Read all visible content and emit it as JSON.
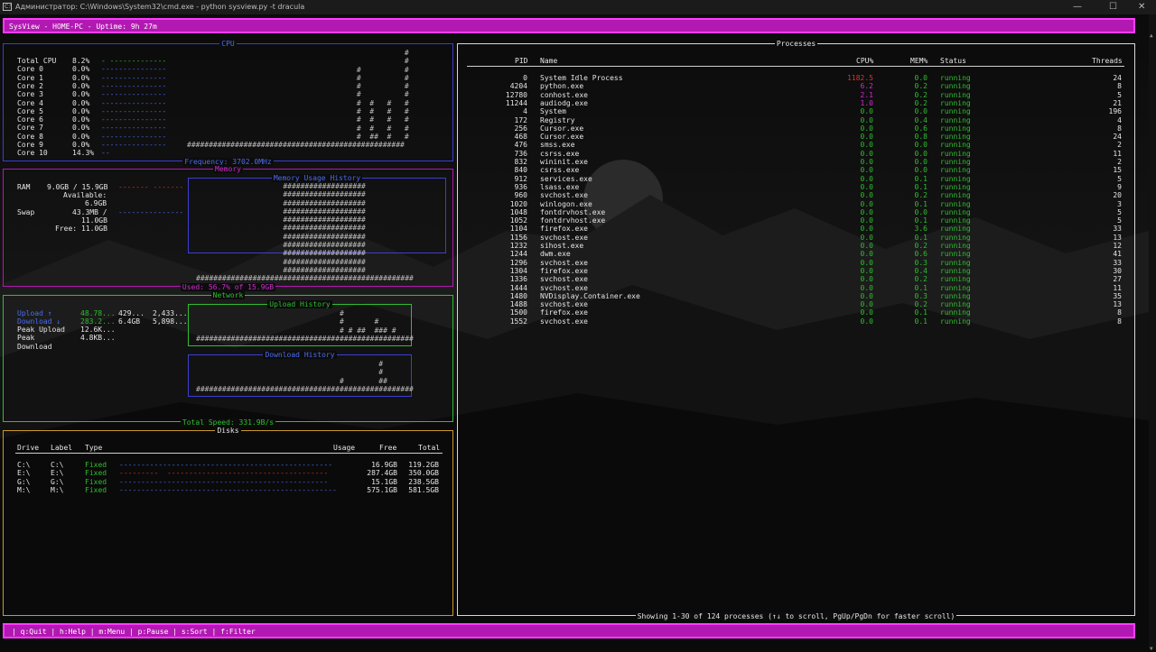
{
  "window": {
    "title": "Администратор: C:\\Windows\\System32\\cmd.exe - python  sysview.py  -t dracula",
    "icon_label": "C:\\",
    "minimize": "—",
    "maximize": "☐",
    "close": "✕"
  },
  "header": {
    "text": "SysView - HOME-PC - Uptime: 9h 27m"
  },
  "footer": {
    "text": "| q:Quit | h:Help | m:Menu | p:Pause | s:Sort | f:Filter"
  },
  "cpu": {
    "title": "CPU",
    "footer": "Frequency: 3702.0MHz",
    "rows": [
      {
        "label": "Total CPU",
        "value": "8.2%",
        "bar": "- -------------"
      },
      {
        "label": "Core 0",
        "value": "0.0%",
        "bar": "---------------"
      },
      {
        "label": "Core 1",
        "value": "0.0%",
        "bar": "---------------"
      },
      {
        "label": "Core 2",
        "value": "0.0%",
        "bar": "---------------"
      },
      {
        "label": "Core 3",
        "value": "0.0%",
        "bar": "---------------"
      },
      {
        "label": "Core 4",
        "value": "0.0%",
        "bar": "---------------"
      },
      {
        "label": "Core 5",
        "value": "0.0%",
        "bar": "---------------"
      },
      {
        "label": "Core 6",
        "value": "0.0%",
        "bar": "---------------"
      },
      {
        "label": "Core 7",
        "value": "0.0%",
        "bar": "---------------"
      },
      {
        "label": "Core 8",
        "value": "0.0%",
        "bar": "---------------"
      },
      {
        "label": "Core 9",
        "value": "0.0%",
        "bar": "---------------"
      },
      {
        "label": "Core 10",
        "value": "14.3%",
        "bar": "--"
      }
    ],
    "graph": [
      "                                                  #",
      "                                                  #",
      "                                       #          #",
      "                                       #          #",
      "                                       #          #",
      "                                       #          #",
      "                                       #  #   #   #",
      "                                       #  #   #   #",
      "                                       #  #   #   #",
      "                                       #  #   #   #",
      "                                       #  ##  #   #",
      "##################################################"
    ]
  },
  "memory": {
    "title": "Memory",
    "footer": "Used: 56.7% of 15.9GB",
    "ram_label": "RAM",
    "ram_value": "9.0GB / 15.9GB",
    "ram_bar": "------- -------",
    "available_label": "Available:",
    "available_value": "6.9GB",
    "swap_label": "Swap",
    "swap_value": "43.3MB /",
    "swap_total": "11.0GB",
    "swap_bar": "---------------",
    "free_label": "Free:",
    "free_value": "11.0GB",
    "history_title": "Memory Usage History",
    "history": [
      "                    ###################",
      "                    ###################",
      "                    ###################",
      "                    ###################",
      "                    ###################",
      "                    ###################",
      "                    ###################",
      "                    ###################",
      "                    ###################",
      "                    ###################",
      "                    ###################",
      "##################################################"
    ]
  },
  "network": {
    "title": "Network",
    "footer": "Total Speed: 331.9B/s",
    "upload_label": "Upload ↑",
    "upload_rate": "48.78...",
    "upload_total": "429...",
    "upload_packets": "2,433...",
    "download_label": "Download ↓",
    "download_rate": "283.2...",
    "download_total": "6.4GB",
    "download_packets": "5,898...",
    "peak_upload_label": "Peak Upload",
    "peak_upload_value": "12.6K...",
    "peak_download_label": "Peak",
    "peak_download_label2": "Download",
    "peak_download_value": "4.8KB...",
    "upload_history_title": "Upload History",
    "upload_history": [
      "                                 #",
      "                                 #       #",
      "                                 # # ##  ### #",
      "##################################################"
    ],
    "download_history_title": "Download History",
    "download_history": [
      "                                          #",
      "                                          #",
      "                                 #        ##",
      "##################################################"
    ]
  },
  "disks": {
    "title": "Disks",
    "headers": [
      "Drive",
      "Label",
      "Type",
      "Usage",
      "Free",
      "Total"
    ],
    "rows": [
      {
        "drive": "C:\\",
        "label": "C:\\",
        "type": "Fixed",
        "bar": "-------------------------------------------------",
        "free": "16.9GB",
        "total": "119.2GB"
      },
      {
        "drive": "E:\\",
        "label": "E:\\",
        "type": "Fixed",
        "bar": "---------  -------------------------------------",
        "free": "287.4GB",
        "total": "350.0GB"
      },
      {
        "drive": "G:\\",
        "label": "G:\\",
        "type": "Fixed",
        "bar": "------------------------------------------------",
        "free": "15.1GB",
        "total": "238.5GB"
      },
      {
        "drive": "M:\\",
        "label": "M:\\",
        "type": "Fixed",
        "bar": "--------------------------------------------------",
        "free": "575.1GB",
        "total": "581.5GB"
      }
    ]
  },
  "processes": {
    "title": "Processes",
    "footer": "Showing 1-30 of 124 processes (↑↓ to scroll, PgUp/PgDn for faster scroll)",
    "headers": [
      "PID",
      "Name",
      "CPU%",
      "MEM%",
      "Status",
      "Threads"
    ],
    "rows": [
      {
        "pid": "0",
        "name": "System Idle Process",
        "cpu": "1182.5",
        "mem": "0.0",
        "status": "running",
        "threads": "24"
      },
      {
        "pid": "4204",
        "name": "python.exe",
        "cpu": "6.2",
        "mem": "0.2",
        "status": "running",
        "threads": "8"
      },
      {
        "pid": "12780",
        "name": "conhost.exe",
        "cpu": "2.1",
        "mem": "0.2",
        "status": "running",
        "threads": "5"
      },
      {
        "pid": "11244",
        "name": "audiodg.exe",
        "cpu": "1.0",
        "mem": "0.2",
        "status": "running",
        "threads": "21"
      },
      {
        "pid": "4",
        "name": "System",
        "cpu": "0.0",
        "mem": "0.0",
        "status": "running",
        "threads": "196"
      },
      {
        "pid": "172",
        "name": "Registry",
        "cpu": "0.0",
        "mem": "0.4",
        "status": "running",
        "threads": "4"
      },
      {
        "pid": "256",
        "name": "Cursor.exe",
        "cpu": "0.0",
        "mem": "0.6",
        "status": "running",
        "threads": "8"
      },
      {
        "pid": "468",
        "name": "Cursor.exe",
        "cpu": "0.0",
        "mem": "0.8",
        "status": "running",
        "threads": "24"
      },
      {
        "pid": "476",
        "name": "smss.exe",
        "cpu": "0.0",
        "mem": "0.0",
        "status": "running",
        "threads": "2"
      },
      {
        "pid": "736",
        "name": "csrss.exe",
        "cpu": "0.0",
        "mem": "0.0",
        "status": "running",
        "threads": "11"
      },
      {
        "pid": "832",
        "name": "wininit.exe",
        "cpu": "0.0",
        "mem": "0.0",
        "status": "running",
        "threads": "2"
      },
      {
        "pid": "840",
        "name": "csrss.exe",
        "cpu": "0.0",
        "mem": "0.0",
        "status": "running",
        "threads": "15"
      },
      {
        "pid": "912",
        "name": "services.exe",
        "cpu": "0.0",
        "mem": "0.1",
        "status": "running",
        "threads": "5"
      },
      {
        "pid": "936",
        "name": "lsass.exe",
        "cpu": "0.0",
        "mem": "0.1",
        "status": "running",
        "threads": "9"
      },
      {
        "pid": "960",
        "name": "svchost.exe",
        "cpu": "0.0",
        "mem": "0.2",
        "status": "running",
        "threads": "20"
      },
      {
        "pid": "1020",
        "name": "winlogon.exe",
        "cpu": "0.0",
        "mem": "0.1",
        "status": "running",
        "threads": "3"
      },
      {
        "pid": "1048",
        "name": "fontdrvhost.exe",
        "cpu": "0.0",
        "mem": "0.0",
        "status": "running",
        "threads": "5"
      },
      {
        "pid": "1052",
        "name": "fontdrvhost.exe",
        "cpu": "0.0",
        "mem": "0.1",
        "status": "running",
        "threads": "5"
      },
      {
        "pid": "1104",
        "name": "firefox.exe",
        "cpu": "0.0",
        "mem": "3.6",
        "status": "running",
        "threads": "33"
      },
      {
        "pid": "1156",
        "name": "svchost.exe",
        "cpu": "0.0",
        "mem": "0.1",
        "status": "running",
        "threads": "13"
      },
      {
        "pid": "1232",
        "name": "sihost.exe",
        "cpu": "0.0",
        "mem": "0.2",
        "status": "running",
        "threads": "12"
      },
      {
        "pid": "1244",
        "name": "dwm.exe",
        "cpu": "0.0",
        "mem": "0.6",
        "status": "running",
        "threads": "41"
      },
      {
        "pid": "1296",
        "name": "svchost.exe",
        "cpu": "0.0",
        "mem": "0.3",
        "status": "running",
        "threads": "33"
      },
      {
        "pid": "1304",
        "name": "firefox.exe",
        "cpu": "0.0",
        "mem": "0.4",
        "status": "running",
        "threads": "30"
      },
      {
        "pid": "1336",
        "name": "svchost.exe",
        "cpu": "0.0",
        "mem": "0.2",
        "status": "running",
        "threads": "27"
      },
      {
        "pid": "1444",
        "name": "svchost.exe",
        "cpu": "0.0",
        "mem": "0.1",
        "status": "running",
        "threads": "11"
      },
      {
        "pid": "1480",
        "name": "NVDisplay.Container.exe",
        "cpu": "0.0",
        "mem": "0.3",
        "status": "running",
        "threads": "35"
      },
      {
        "pid": "1488",
        "name": "svchost.exe",
        "cpu": "0.0",
        "mem": "0.2",
        "status": "running",
        "threads": "13"
      },
      {
        "pid": "1500",
        "name": "firefox.exe",
        "cpu": "0.0",
        "mem": "0.1",
        "status": "running",
        "threads": "8"
      },
      {
        "pid": "1552",
        "name": "svchost.exe",
        "cpu": "0.0",
        "mem": "0.1",
        "status": "running",
        "threads": "8"
      }
    ]
  }
}
